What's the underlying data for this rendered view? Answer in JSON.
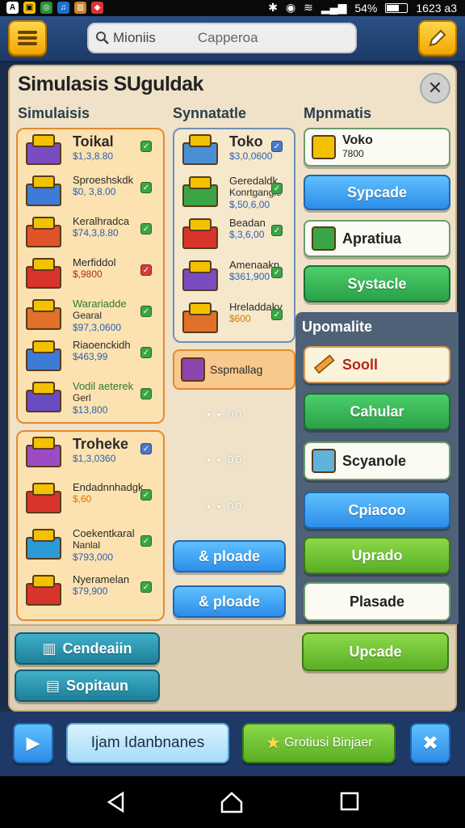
{
  "status": {
    "time": "1623 a3",
    "battery": "54%",
    "icons": [
      "notification-a-icon",
      "notification-lock-icon",
      "notification-sync-icon",
      "notification-music-icon",
      "notification-bars-icon",
      "notification-game-icon"
    ]
  },
  "topbar": {
    "search_value": "Mioniis",
    "search_placeholder": "Capperoa"
  },
  "panel": {
    "title": "Simulasis SUguldak",
    "close_label": "✕",
    "columns": [
      "Simulaisis",
      "Synnatatle",
      "Mpnmatis"
    ]
  },
  "left_card1": {
    "items": [
      {
        "name": "Toikal",
        "price": "$1,3,8.80",
        "check": "green",
        "color": "#7a4cc2"
      },
      {
        "name": "Sproeshskdk",
        "price": "$0, 3,8.00",
        "check": "green",
        "color": "#3d7bd6"
      },
      {
        "name": "Keralhradca",
        "price": "$74,3,8.80",
        "check": "green",
        "color": "#e0532a"
      },
      {
        "name": "Merfiddol",
        "price": "$,9800",
        "check": "red",
        "color": "#d9342b"
      },
      {
        "name": "Warariadde",
        "sub": "Gearal",
        "price": "$97,3,0600",
        "check": "green",
        "color": "#e0702a"
      },
      {
        "name": "Riaoenckidh",
        "price": "$463,99",
        "check": "green",
        "color": "#3d7bd6"
      },
      {
        "name": "Vodil aeterek",
        "sub": "Gerl",
        "price": "$13,800",
        "check": "green",
        "color": "#6a4cc2"
      }
    ]
  },
  "left_card2": {
    "items": [
      {
        "name": "Troheke",
        "price": "$1,3,0360",
        "check": "blue",
        "color": "#9b4cc2"
      },
      {
        "name": "Endadnnhadgk",
        "price": "$,60",
        "check": "green",
        "color": "#d9342b"
      },
      {
        "name": "Coekentkaral",
        "sub": "Nanlal",
        "price": "$793,000",
        "check": "green",
        "color": "#2a9bd6"
      },
      {
        "name": "Nyeramelan",
        "price": "$79,900",
        "check": "green",
        "color": "#d9342b"
      }
    ]
  },
  "mid_card": {
    "items": [
      {
        "name": "Toko",
        "price": "$3,0,0600",
        "check": "blue",
        "color": "#4a8fd6"
      },
      {
        "name": "Geredaldk",
        "sub": "Konrtgangle",
        "price": "$,50,6,00",
        "check": "green",
        "color": "#3aa544"
      },
      {
        "name": "Beadan",
        "price": "$,3,6,00",
        "check": "green",
        "color": "#d9342b"
      },
      {
        "name": "Amenaakn",
        "price": "$361,900",
        "check": "green",
        "color": "#7a4cc2"
      },
      {
        "name": "Hreladdaky",
        "price": "$600",
        "check": "green",
        "color": "#e0702a"
      }
    ]
  },
  "mid_wide_item": {
    "name": "Sspmallag"
  },
  "mid_dots": [
    "• • 00",
    "• • 00",
    "• • 00"
  ],
  "mid_buttons": [
    "& ploade",
    "& ploade"
  ],
  "right_top": [
    {
      "kind": "white",
      "name": "Voko",
      "sub": "7800",
      "icon": "box-icon"
    },
    {
      "kind": "blue",
      "label": "Sypcade"
    },
    {
      "kind": "white",
      "name": "Apratiua",
      "icon": "crate-icon"
    },
    {
      "kind": "green",
      "label": "Systacle"
    }
  ],
  "right_sub": {
    "header": "Upomalite",
    "buttons": [
      {
        "kind": "cream",
        "label": "Sooll",
        "icon": "pencil-icon"
      },
      {
        "kind": "green",
        "label": "Cahular"
      },
      {
        "kind": "white",
        "label": "Scyanole",
        "icon": "package-icon"
      },
      {
        "kind": "blue",
        "label": "Cpiacoo"
      },
      {
        "kind": "lime",
        "label": "Uprado"
      },
      {
        "kind": "white",
        "label": "Plasade"
      }
    ]
  },
  "footer": {
    "left_buttons": [
      "Cendeaiin",
      "Sopitaun"
    ],
    "right_button": "Upcade"
  },
  "bottombar": {
    "play_icon": "▶",
    "center_label": "Ijam Idanbnanes",
    "star_label": "Grotiusi Binjaer",
    "right_icon": "✖"
  }
}
